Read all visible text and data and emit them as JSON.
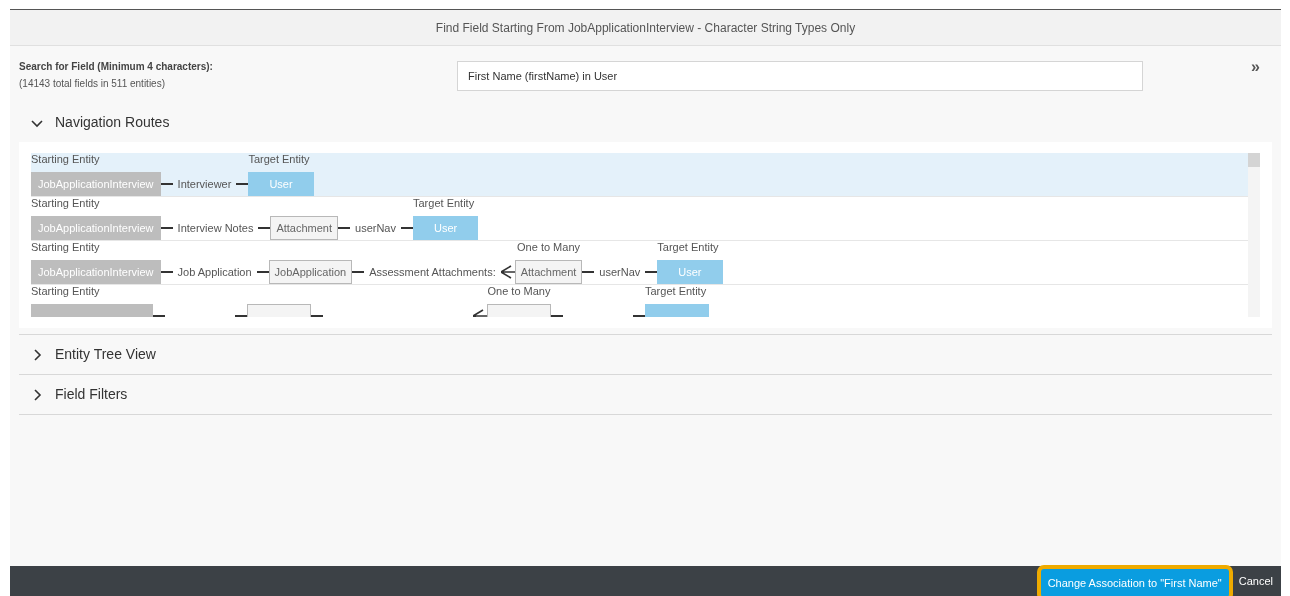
{
  "dialog": {
    "title": "Find Field Starting From JobApplicationInterview - Character String Types Only"
  },
  "search": {
    "label": "Search for Field (Minimum 4 characters):",
    "hint": "(14143 total fields in 511 entities)",
    "value": "First Name (firstName) in User",
    "more": "»"
  },
  "sections": [
    {
      "title": "Navigation Routes",
      "expanded": true,
      "routes": [
        {
          "selected": true,
          "steps": [
            {
              "kind": "start",
              "label": "JobApplicationInterview",
              "caption": "Starting Entity"
            },
            {
              "kind": "link",
              "label": "Interviewer",
              "many": false
            },
            {
              "kind": "target",
              "label": "User",
              "caption": "Target Entity"
            }
          ]
        },
        {
          "selected": false,
          "steps": [
            {
              "kind": "start",
              "label": "JobApplicationInterview",
              "caption": "Starting Entity"
            },
            {
              "kind": "link",
              "label": "Interview Notes",
              "many": false
            },
            {
              "kind": "entity",
              "label": "Attachment"
            },
            {
              "kind": "link",
              "label": "userNav",
              "many": false
            },
            {
              "kind": "target",
              "label": "User",
              "caption": "Target Entity"
            }
          ]
        },
        {
          "selected": false,
          "steps": [
            {
              "kind": "start",
              "label": "JobApplicationInterview",
              "caption": "Starting Entity"
            },
            {
              "kind": "link",
              "label": "Job Application",
              "many": false
            },
            {
              "kind": "entity",
              "label": "JobApplication"
            },
            {
              "kind": "link",
              "label": "Assessment Attachments:",
              "many": true
            },
            {
              "kind": "entity",
              "label": "Attachment",
              "caption": "One to Many"
            },
            {
              "kind": "link",
              "label": "userNav",
              "many": false
            },
            {
              "kind": "target",
              "label": "User",
              "caption": "Target Entity"
            }
          ]
        },
        {
          "selected": false,
          "steps": [
            {
              "kind": "start",
              "caption": "Starting Entity"
            },
            {
              "kind": "link",
              "many": false
            },
            {
              "kind": "entity"
            },
            {
              "kind": "link",
              "many": true
            },
            {
              "kind": "entity",
              "caption": "One to Many"
            },
            {
              "kind": "link",
              "many": false
            },
            {
              "kind": "target",
              "caption": "Target Entity"
            }
          ]
        }
      ]
    },
    {
      "title": "Entity Tree View",
      "expanded": false
    },
    {
      "title": "Field Filters",
      "expanded": false
    }
  ],
  "footer": {
    "buttons": [
      {
        "label": "Change Association to \"First Name\"",
        "kind": "primary",
        "focused": true
      },
      {
        "label": "Cancel",
        "kind": "plain",
        "focused": false
      }
    ]
  }
}
